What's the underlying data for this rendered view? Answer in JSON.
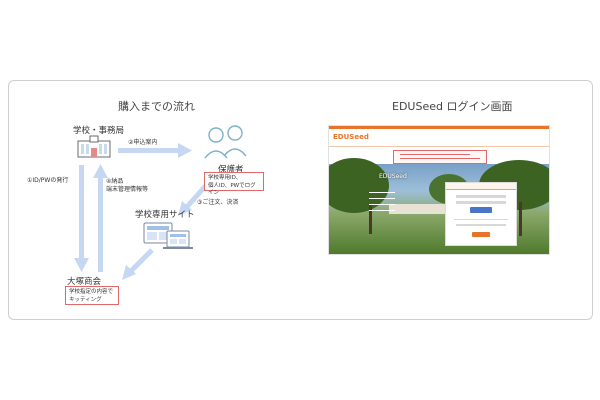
{
  "left_panel": {
    "title": "購入までの流れ",
    "school": {
      "label": "学校・事務局"
    },
    "guardian": {
      "label": "保護者",
      "login_box": [
        "学校専用ID、",
        "個人ID、PWでログイン"
      ]
    },
    "site": {
      "label": "学校専用サイト"
    },
    "vendor": {
      "label": "大塚商会",
      "kitting_box": [
        "学校指定の内容で",
        "キッティング"
      ]
    },
    "steps": {
      "s1": "①ID/PWの発行",
      "s2": "②申込案内",
      "s3": "③ご注文、決済",
      "s4_line1": "④納品",
      "s4_line2": "端末管理情報等"
    }
  },
  "right_panel": {
    "title": "EDUSeed ログイン画面",
    "logo": "EDUSeed"
  },
  "colors": {
    "arrow": "#c5d7f2",
    "border_red": "#e06a6a",
    "accent_orange": "#e8742a",
    "person_line": "#7fb0c8"
  }
}
